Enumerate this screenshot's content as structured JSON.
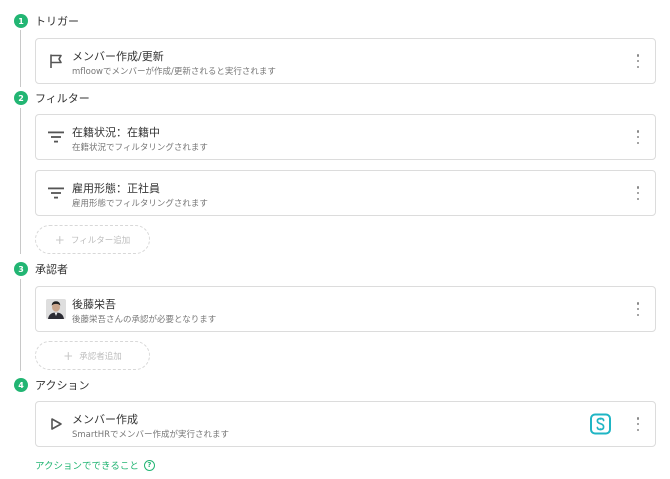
{
  "steps": [
    {
      "num": "1",
      "title": "トリガー"
    },
    {
      "num": "2",
      "title": "フィルター"
    },
    {
      "num": "3",
      "title": "承認者"
    },
    {
      "num": "4",
      "title": "アクション"
    }
  ],
  "trigger": {
    "title": "メンバー作成/更新",
    "desc": "mfloowでメンバーが作成/更新されると実行されます",
    "icon": "flag-icon"
  },
  "filters": [
    {
      "title": "在籍状況：在籍中",
      "desc": "在籍状況でフィルタリングされます",
      "icon": "filter-icon"
    },
    {
      "title": "雇用形態：正社員",
      "desc": "雇用形態でフィルタリングされます",
      "icon": "filter-icon"
    }
  ],
  "add_filter_label": "フィルター追加",
  "approver": {
    "title": "後藤栄吾",
    "desc": "後藤栄吾さんの承認が必要となります",
    "icon": "avatar"
  },
  "add_approver_label": "承認者追加",
  "action": {
    "title": "メンバー作成",
    "desc": "SmartHRでメンバー作成が実行されます",
    "icon": "play-icon",
    "service_icon": "smarthr-logo-icon"
  },
  "help_link": "アクションでできること",
  "colors": {
    "accent": "#22b573",
    "smarthr": "#1fb5c4"
  }
}
